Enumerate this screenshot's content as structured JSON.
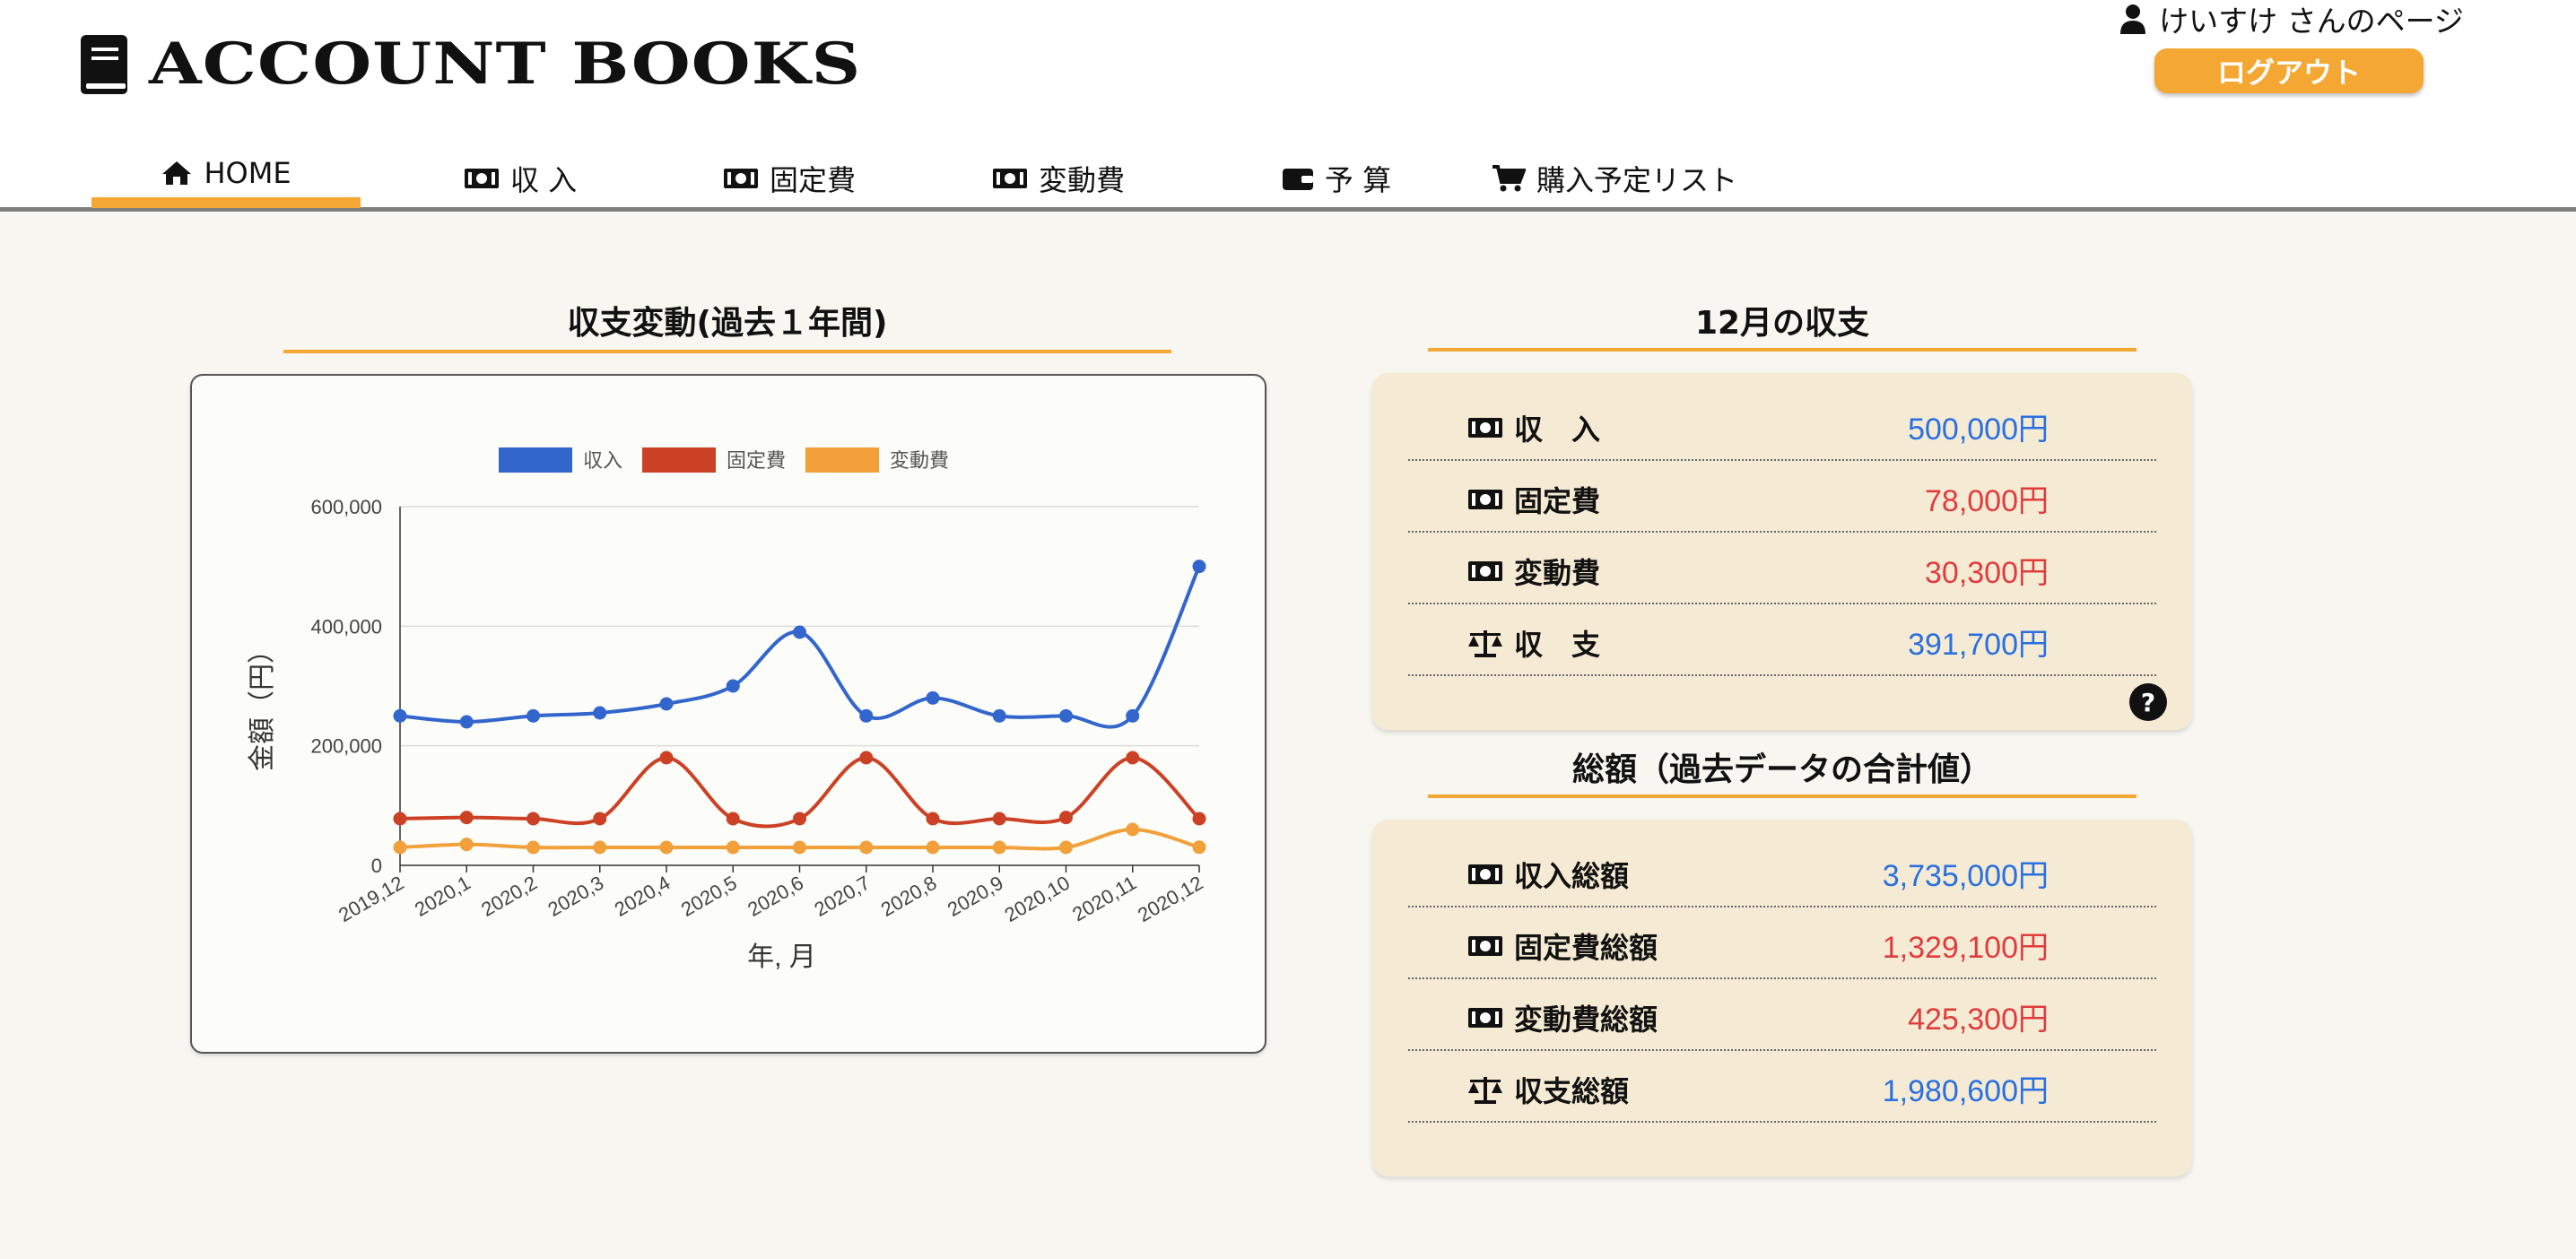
{
  "brand": {
    "title": "ACCOUNT BOOKS"
  },
  "user": {
    "greeting": "けいすけ さんのページ",
    "logout_label": "ログアウト"
  },
  "nav": {
    "items": [
      {
        "label": "HOME",
        "icon": "home-icon",
        "active": true
      },
      {
        "label": "収 入",
        "icon": "money-icon"
      },
      {
        "label": "固定費",
        "icon": "money-icon"
      },
      {
        "label": "変動費",
        "icon": "money-icon"
      },
      {
        "label": "予 算",
        "icon": "wallet-icon"
      },
      {
        "label": "購入予定リスト",
        "icon": "cart-icon"
      }
    ]
  },
  "chart_section": {
    "title": "収支変動(過去１年間)"
  },
  "chart_data": {
    "type": "line",
    "categories": [
      "2019,12",
      "2020,1",
      "2020,2",
      "2020,3",
      "2020,4",
      "2020,5",
      "2020,6",
      "2020,7",
      "2020,8",
      "2020,9",
      "2020,10",
      "2020,11",
      "2020,12"
    ],
    "series": [
      {
        "name": "収入",
        "color": "#3366cc",
        "values": [
          250000,
          240000,
          250000,
          255000,
          270000,
          300000,
          390000,
          250000,
          280000,
          250000,
          250000,
          250000,
          500000
        ]
      },
      {
        "name": "固定費",
        "color": "#cc4125",
        "values": [
          78000,
          80000,
          78000,
          78000,
          180000,
          78000,
          78000,
          180000,
          78000,
          78000,
          80000,
          180000,
          78000
        ]
      },
      {
        "name": "変動費",
        "color": "#f1a03a",
        "values": [
          30000,
          35000,
          30000,
          30000,
          30000,
          30000,
          30000,
          30000,
          30000,
          30000,
          30000,
          60000,
          30300
        ]
      }
    ],
    "xlabel": "年, 月",
    "ylabel": "金額（円）",
    "ylim": [
      0,
      600000
    ],
    "yticks": [
      "0",
      "200,000",
      "400,000",
      "600,000"
    ],
    "legend": "top",
    "grid": true
  },
  "monthly": {
    "title": "12月の収支",
    "rows": [
      {
        "label": "収　入",
        "value": "500,000円",
        "icon": "money-icon",
        "color": "blue"
      },
      {
        "label": "固定費",
        "value": "78,000円",
        "icon": "money-icon",
        "color": "red"
      },
      {
        "label": "変動費",
        "value": "30,300円",
        "icon": "money-icon",
        "color": "red"
      },
      {
        "label": "収　支",
        "value": "391,700円",
        "icon": "balance-scale-icon",
        "color": "blue"
      }
    ],
    "help": "?"
  },
  "totals": {
    "title": "総額（過去データの合計値）",
    "rows": [
      {
        "label": "収入総額",
        "value": "3,735,000円",
        "icon": "money-icon",
        "color": "blue"
      },
      {
        "label": "固定費総額",
        "value": "1,329,100円",
        "icon": "money-icon",
        "color": "red"
      },
      {
        "label": "変動費総額",
        "value": "425,300円",
        "icon": "money-icon",
        "color": "red"
      },
      {
        "label": "収支総額",
        "value": "1,980,600円",
        "icon": "balance-scale-icon",
        "color": "blue"
      }
    ]
  }
}
